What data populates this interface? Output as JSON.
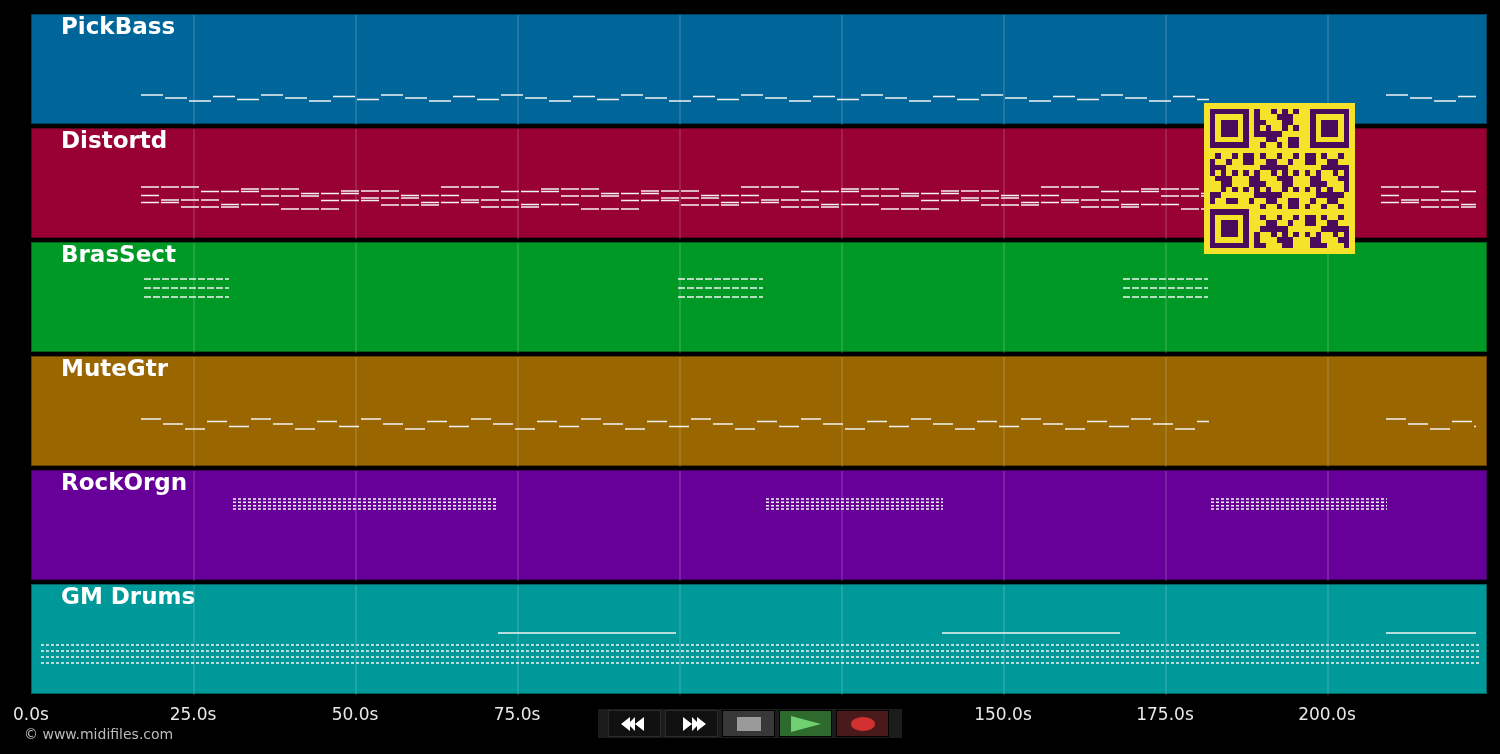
{
  "tracks": [
    {
      "name": "PickBass",
      "color": "#006699",
      "kind": "bass"
    },
    {
      "name": "Distortd",
      "color": "#990033",
      "kind": "lead"
    },
    {
      "name": "BrasSect",
      "color": "#009926",
      "kind": "brass"
    },
    {
      "name": "MuteGtr",
      "color": "#996600",
      "kind": "guitar"
    },
    {
      "name": "RockOrgn",
      "color": "#660099",
      "kind": "organ"
    },
    {
      "name": "GM Drums",
      "color": "#009999",
      "kind": "drums"
    }
  ],
  "time_axis": {
    "ticks": [
      {
        "label": "0.0s",
        "covered": false
      },
      {
        "label": "25.0s",
        "covered": false
      },
      {
        "label": "50.0s",
        "covered": false
      },
      {
        "label": "75.0s",
        "covered": false
      },
      {
        "covered": true
      },
      {
        "covered": true
      },
      {
        "label": "150.0s",
        "covered": false
      },
      {
        "label": "175.0s",
        "covered": false
      },
      {
        "label": "200.0s",
        "covered": false
      }
    ]
  },
  "qr_code": {
    "kind": "qr"
  },
  "transport": [
    {
      "kind": "rewind"
    },
    {
      "kind": "forward"
    },
    {
      "kind": "stop"
    },
    {
      "kind": "play"
    },
    {
      "kind": "record"
    }
  ],
  "copyright": "© www.midifiles.com"
}
